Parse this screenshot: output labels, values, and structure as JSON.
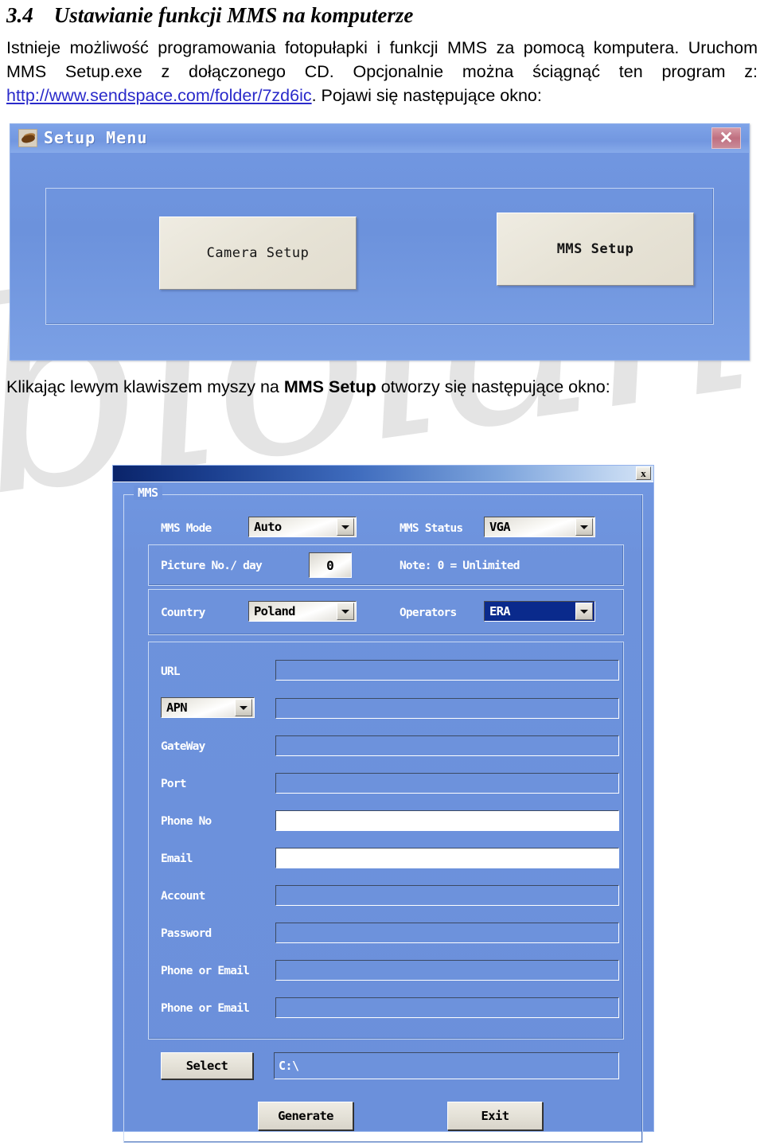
{
  "heading": {
    "number": "3.4",
    "title": "Ustawianie funkcji MMS na komputerze"
  },
  "paragraph1": {
    "line1": "Istnieje możliwość programowania fotopułapki i funkcji MMS za pomocą komputera.",
    "line2": "Uruchom MMS Setup.exe z dołączonego CD. Opcjonalnie można ściągnąć ten",
    "line3_pre": "program z: ",
    "link": "http://www.sendspace.com/folder/7zd6ic",
    "line3_post": ". Pojawi się następujące okno:"
  },
  "paragraph2": {
    "pre": "Klikając lewym klawiszem myszy na ",
    "bold": "MMS Setup",
    "post": " otworzy się następujące okno:"
  },
  "watermark": {
    "text": "biolan"
  },
  "setup_window": {
    "title": "Setup Menu",
    "icon": "app-icon",
    "close_label": "✕",
    "camera_setup_label": "Camera Setup",
    "mms_setup_label": "MMS Setup"
  },
  "mms_window": {
    "close_label": "x",
    "group_legend": "MMS",
    "rows": {
      "mms_mode_label": "MMS Mode",
      "mms_mode_value": "Auto",
      "mms_status_label": "MMS Status",
      "mms_status_value": "VGA",
      "picture_no_label": "Picture No./ day",
      "picture_no_value": "0",
      "note": "Note: 0 = Unlimited",
      "country_label": "Country",
      "country_value": "Poland",
      "operators_label": "Operators",
      "operators_value": "ERA",
      "url_label": "URL",
      "url_value": "",
      "apn_label": "APN",
      "apn_value": "",
      "gateway_label": "GateWay",
      "gateway_value": "",
      "port_label": "Port",
      "port_value": "",
      "phone_no_label": "Phone No",
      "phone_no_value": "",
      "email_label": "Email",
      "email_value": "",
      "account_label": "Account",
      "account_value": "",
      "password_label": "Password",
      "password_value": "",
      "phone_or_email_1_label": "Phone or Email",
      "phone_or_email_1_value": "",
      "phone_or_email_2_label": "Phone or Email",
      "phone_or_email_2_value": "",
      "select_label": "Select",
      "path_value": "C:\\",
      "generate_label": "Generate",
      "exit_label": "Exit"
    }
  },
  "colors": {
    "dialog_blue": "#6d92dc",
    "titlebar_dark": "#0a246a",
    "button_face": "#e3e0d6",
    "selection_blue": "#0a2a8c",
    "link": "#2a2aca",
    "label_white": "#ffffff"
  }
}
